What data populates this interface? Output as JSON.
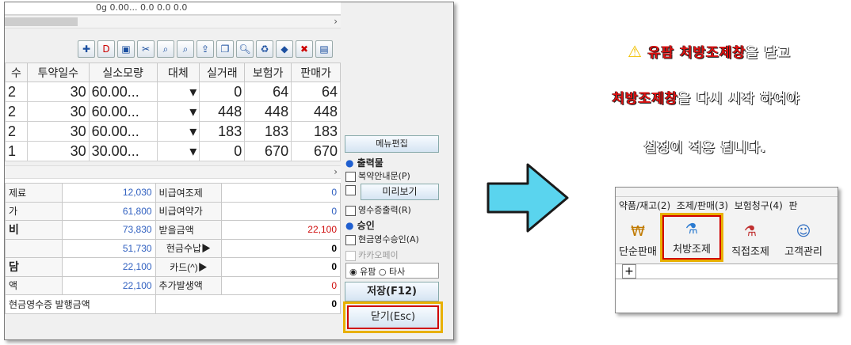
{
  "left_panel": {
    "top_row_text": "0g   0.00...      0.0    0.0    0.0",
    "toolbar_icons": [
      "bag-plus-icon",
      "dur-plus-icon",
      "screen-icon",
      "scissors-icon",
      "search-doc-icon",
      "search-doc2-icon",
      "export-icon",
      "copy-icon",
      "doc-search-icon",
      "recycle-icon",
      "pill-icon",
      "delete-icon",
      "delete-all-icon"
    ],
    "columns": [
      "수",
      "투약일수",
      "실소모량",
      "대체",
      "실거래",
      "보험가",
      "판매가"
    ],
    "rows": [
      {
        "c0": "2",
        "days": "30",
        "qty": "60.00...",
        "sub": "▾",
        "actual": "0",
        "ins": "64",
        "sale": "64"
      },
      {
        "c0": "2",
        "days": "30",
        "qty": "60.00...",
        "sub": "▾",
        "actual": "448",
        "ins": "448",
        "sale": "448"
      },
      {
        "c0": "2",
        "days": "30",
        "qty": "60.00...",
        "sub": "▾",
        "actual": "183",
        "ins": "183",
        "sale": "183"
      },
      {
        "c0": "1",
        "days": "30",
        "qty": "30.00...",
        "sub": "▾",
        "actual": "0",
        "ins": "670",
        "sale": "670"
      }
    ],
    "summary": [
      {
        "label": "제료",
        "value": "12,030",
        "label2": "비급여조제",
        "value2": "0"
      },
      {
        "label": "가",
        "value": "61,800",
        "label2": "비급여약가",
        "value2": "0"
      },
      {
        "label": "비",
        "value": "73,830",
        "label2": "받을금액",
        "value2": "22,100"
      },
      {
        "label": "",
        "value": "51,730",
        "label2": "현금수납▶",
        "value2": "0"
      },
      {
        "label": "담",
        "value": "22,100",
        "label2": "카드(^)▶",
        "value2": "0"
      },
      {
        "label": "액",
        "value": "22,100",
        "label2": "추가발생액",
        "value2": "0"
      },
      {
        "label": "현금영수증 발행금액",
        "value": "",
        "label2": "",
        "value2": "0"
      }
    ],
    "side": {
      "menu_edit": "메뉴편집",
      "output_title": "출력물",
      "opt1": "복약안내문(P)",
      "preview": "미리보기",
      "opt2": "영수증출력(R)",
      "approve_title": "승인",
      "opt3": "현금영수승인(A)",
      "kakao": "카카오페이",
      "radio1": "유팜",
      "radio2": "타사",
      "save": "저장(F12)",
      "close": "닫기(Esc)"
    }
  },
  "message": {
    "line1_red": "유팜 처방조제창",
    "line1_black": "을 닫고",
    "line2_red": "처방조제창",
    "line2_black": "을 다시 시작 하여야",
    "line3": "설정이 적용 됩니다."
  },
  "right_panel": {
    "menu_items": [
      "약품/재고(2)",
      "조제/판매(3)",
      "보험청구(4)",
      "판"
    ],
    "tools": [
      {
        "label": "단순판매",
        "icon": "sale-icon"
      },
      {
        "label": "처방조제",
        "icon": "prescription-icon"
      },
      {
        "label": "직접조제",
        "icon": "direct-dispense-icon"
      },
      {
        "label": "고객관리",
        "icon": "customer-icon"
      }
    ],
    "tab_plus": "+"
  },
  "colors": {
    "highlight_border": "#e8b000",
    "highlight_inner": "#d00000",
    "arrow": "#5ad4ee",
    "red_text": "#e01010"
  }
}
